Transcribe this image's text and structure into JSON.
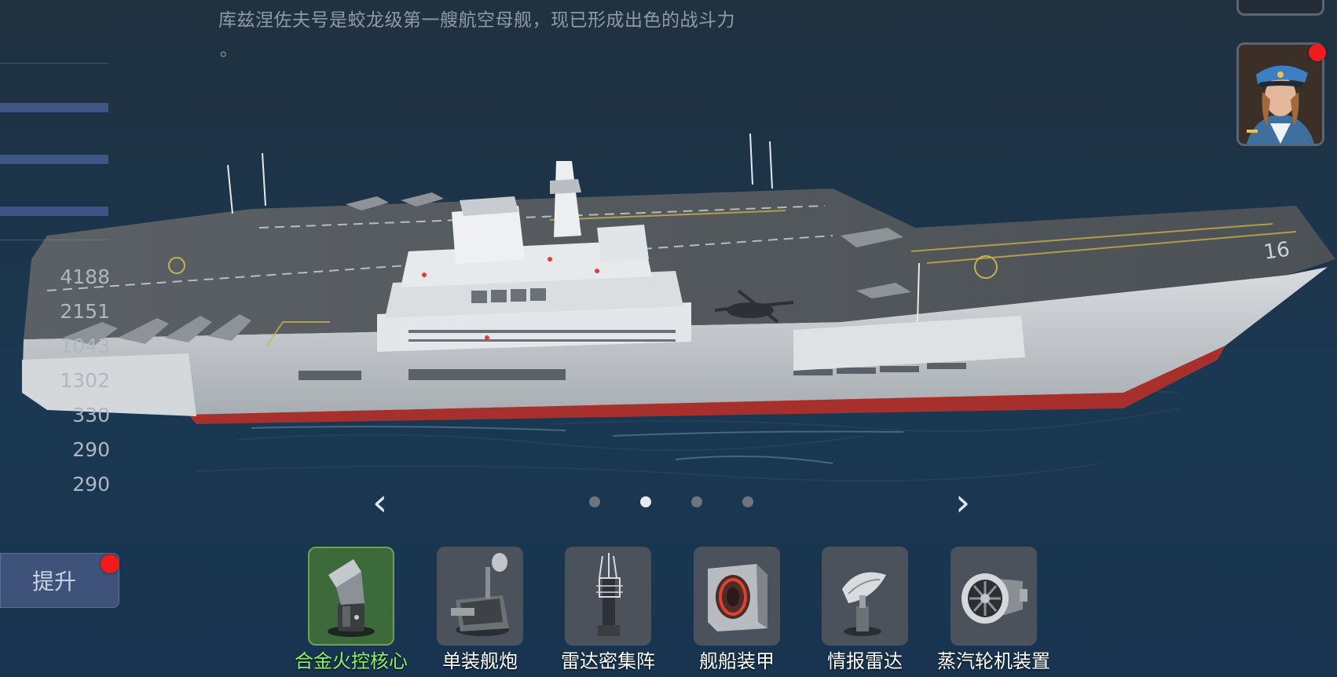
{
  "description": {
    "line1": "库兹涅佐夫号是蛟龙级第一艘航空母舰，现已形成出色的战斗力",
    "line2": "。"
  },
  "stats": {
    "values": [
      "4188",
      "2151",
      "1043",
      "1302",
      "330",
      "290",
      "290"
    ]
  },
  "upgrade": {
    "label": "提升"
  },
  "pagination": {
    "prev": "‹",
    "next": "›",
    "pages": 4,
    "active_index": 1
  },
  "ship": {
    "hull_number": "16"
  },
  "equipment": [
    {
      "label": "合金火控核心",
      "icon": "fire-control-icon",
      "selected": true
    },
    {
      "label": "单装舰炮",
      "icon": "naval-gun-icon",
      "selected": false
    },
    {
      "label": "雷达密集阵",
      "icon": "radar-array-icon",
      "selected": false
    },
    {
      "label": "舰船装甲",
      "icon": "ship-armor-icon",
      "selected": false
    },
    {
      "label": "情报雷达",
      "icon": "intel-radar-icon",
      "selected": false
    },
    {
      "label": "蒸汽轮机装置",
      "icon": "steam-turbine-icon",
      "selected": false
    }
  ],
  "colors": {
    "selected_label": "#8ef06a",
    "notification_dot": "#f21b1b",
    "stat_bar": "#3f5585"
  }
}
